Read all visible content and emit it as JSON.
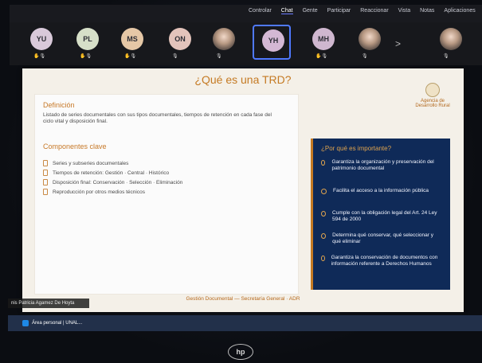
{
  "top_menu": {
    "items": [
      "Controlar",
      "Chat",
      "Gente",
      "Participar",
      "Reaccionar",
      "Vista",
      "Notas",
      "Aplicaciones"
    ],
    "active_index": 1
  },
  "participants": [
    {
      "initials": "YU",
      "color": "#d9c9da"
    },
    {
      "initials": "PL",
      "color": "#d6dfc8"
    },
    {
      "initials": "MS",
      "color": "#e5c7a6"
    },
    {
      "initials": "ON",
      "color": "#e3c3bb"
    },
    {
      "initials": "",
      "color": ""
    },
    {
      "initials": "YH",
      "color": "#d4b8d4"
    },
    {
      "initials": "MH",
      "color": "#cfb7cf"
    },
    {
      "initials": "",
      "color": ""
    },
    {
      "initials": "",
      "color": ""
    }
  ],
  "participants_extra": {
    "chevron": ">"
  },
  "slide": {
    "title": "¿Qué es una TRD?",
    "brand": {
      "line1": "Agencia de",
      "line2": "Desarrollo Rural"
    },
    "definition": {
      "heading": "Definición",
      "text": "Listado de series documentales con sus tipos documentales, tiempos de retención en cada fase del ciclo vital y disposición final."
    },
    "key_components": {
      "heading": "Componentes clave",
      "items": [
        "Series y subseries documentales",
        "Tiempos de retención: Gestión · Central · Histórico",
        "Disposición final: Conservación · Selección · Eliminación",
        "Reproducción por otros medios técnicos"
      ]
    },
    "importance": {
      "heading": "¿Por qué es importante?",
      "items": [
        "Garantiza la organización y preservación del patrimonio documental",
        "Facilita el acceso a la información pública",
        "Cumple con la obligación legal del Art. 24 Ley 594 de 2000",
        "Determina qué conservar, qué seleccionar y qué eliminar",
        "Garantiza la conservación de documentos con información referente a Derechos Humanos"
      ]
    },
    "footer": "Gestión Documental — Secretaría General · ADR"
  },
  "name_label": "nis Patricia Agamez De Hoyta",
  "taskbar": {
    "item_label": "Área personal | UNAL..."
  },
  "hp_logo_text": "hp"
}
